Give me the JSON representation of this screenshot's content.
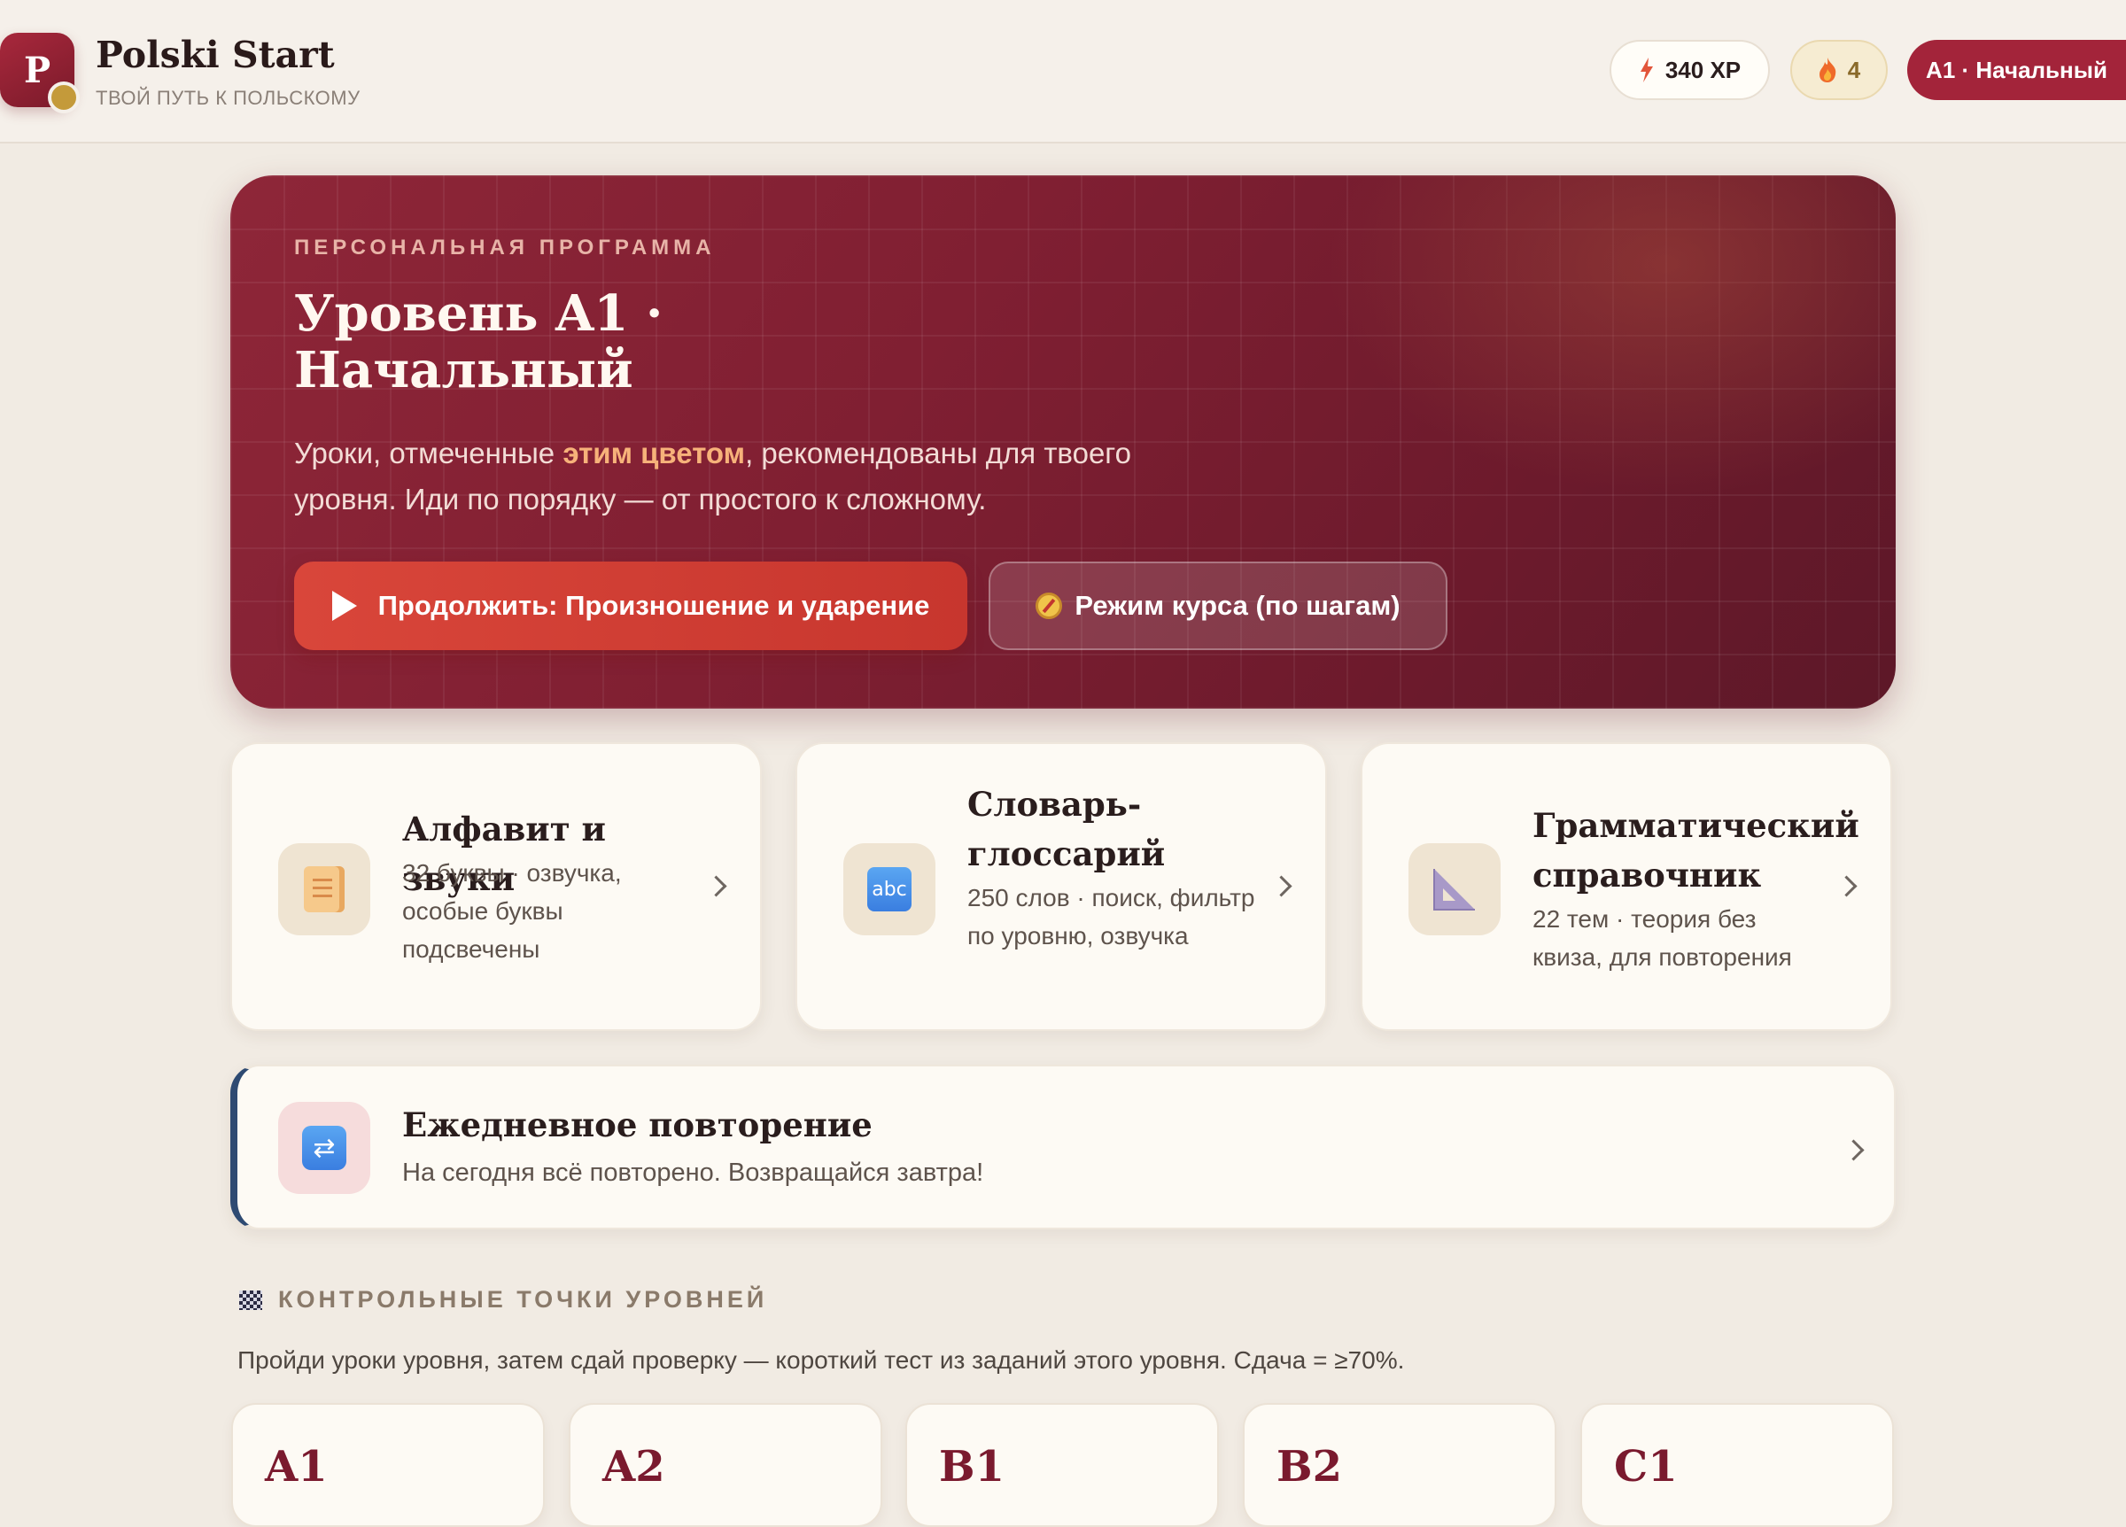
{
  "header": {
    "logo_letter": "P",
    "title": "Polski Start",
    "subtitle": "ТВОЙ ПУТЬ К ПОЛЬСКОМУ",
    "xp": "340 XP",
    "xp_icon": "lightning-icon",
    "streak": "4",
    "streak_icon": "flame-icon",
    "level": "A1 · Начальный"
  },
  "hero": {
    "eyebrow": "ПЕРСОНАЛЬНАЯ ПРОГРАММА",
    "title": "Уровень A1 · Начальный",
    "desc_before": "Уроки, отмеченные ",
    "desc_highlight": "этим цветом",
    "desc_after": ", рекомендованы для твоего уровня. Иди по порядку — от простого к сложному.",
    "primary_button": "Продолжить: Произношение и ударение",
    "secondary_button": "Режим курса (по шагам)"
  },
  "cards": [
    {
      "title": "Алфавит и звуки",
      "desc": "32 буквы · озвучка, особые буквы подсвечены",
      "icon": "scroll-icon"
    },
    {
      "title": "Словарь-глоссарий",
      "desc": "250 слов · поиск, фильтр по уровню, озвучка",
      "icon": "abc-icon",
      "icon_text": "abc"
    },
    {
      "title": "Грамматический справочник",
      "desc": "22 тем · теория без квиза, для повторения",
      "icon": "triangle-ruler-icon"
    }
  ],
  "review": {
    "title": "Ежедневное повторение",
    "desc": "На сегодня всё повторено. Возвращайся завтра!",
    "icon": "repeat-icon"
  },
  "checkpoints": {
    "heading": "КОНТРОЛЬНЫЕ ТОЧКИ УРОВНЕЙ",
    "desc": "Пройди уроки уровня, затем сдай проверку — короткий тест из заданий этого уровня. Сдача = ≥70%.",
    "levels": [
      "A1",
      "A2",
      "B1",
      "B2",
      "C1"
    ]
  },
  "colors": {
    "accent": "#a3243a",
    "hero_bg": "#801f32",
    "primary_button": "#d9463a",
    "highlight": "#f7b27a",
    "review_border": "#2e4a72"
  }
}
